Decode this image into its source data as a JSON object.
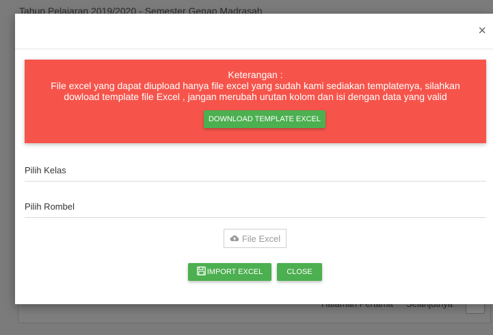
{
  "background": {
    "title": "Tahun Pelajaran 2019/2020 - Semester Genap Madrasah",
    "footer_left": "",
    "footer_middle": "Halaman Pertama",
    "footer_right": "Selanjutnya"
  },
  "modal": {
    "close_symbol": "×",
    "alert": {
      "heading": "Keterangan :",
      "line1": "File excel yang dapat diupload hanya file excel yang sudah kami sediakan templatenya, silahkan",
      "line2": "dowload template file Excel , jangan merubah urutan kolom dan isi dengan data yang valid",
      "download_label": "DOWNLOAD TEMPLATE EXCEL"
    },
    "fields": {
      "kelas_label": "Pilih Kelas",
      "rombel_label": "Pilih Rombel"
    },
    "file_button_label": "File Excel",
    "import_label": "IMPORT EXCEL",
    "close_label": "CLOSE"
  },
  "colors": {
    "alert_bg": "#f6544b",
    "button_green": "#4caf50"
  },
  "icons": {
    "file": "cloud-upload-icon",
    "import": "save-icon",
    "close": "close-icon"
  }
}
